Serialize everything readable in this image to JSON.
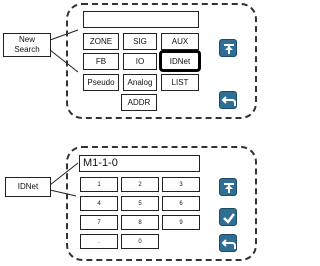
{
  "screen1": {
    "callout_label": "New\nSearch",
    "display_value": "",
    "buttons": [
      "ZONE",
      "SIG",
      "AUX",
      "FB",
      "IO",
      "IDNet",
      "Pseudo",
      "Analog",
      "LIST",
      "ADDR"
    ],
    "selected_button": "IDNet",
    "icons": [
      "pin-up-icon",
      "back-arrow-icon"
    ]
  },
  "screen2": {
    "callout_label": "IDNet",
    "display_value": "M1-1-0",
    "keys": [
      "1",
      "2",
      "3",
      "4",
      "5",
      "6",
      "7",
      "8",
      "9",
      ".",
      "0"
    ],
    "icons": [
      "pin-up-icon",
      "check-icon",
      "back-arrow-icon"
    ]
  },
  "colors": {
    "icon_bg": "#2f6f95"
  }
}
